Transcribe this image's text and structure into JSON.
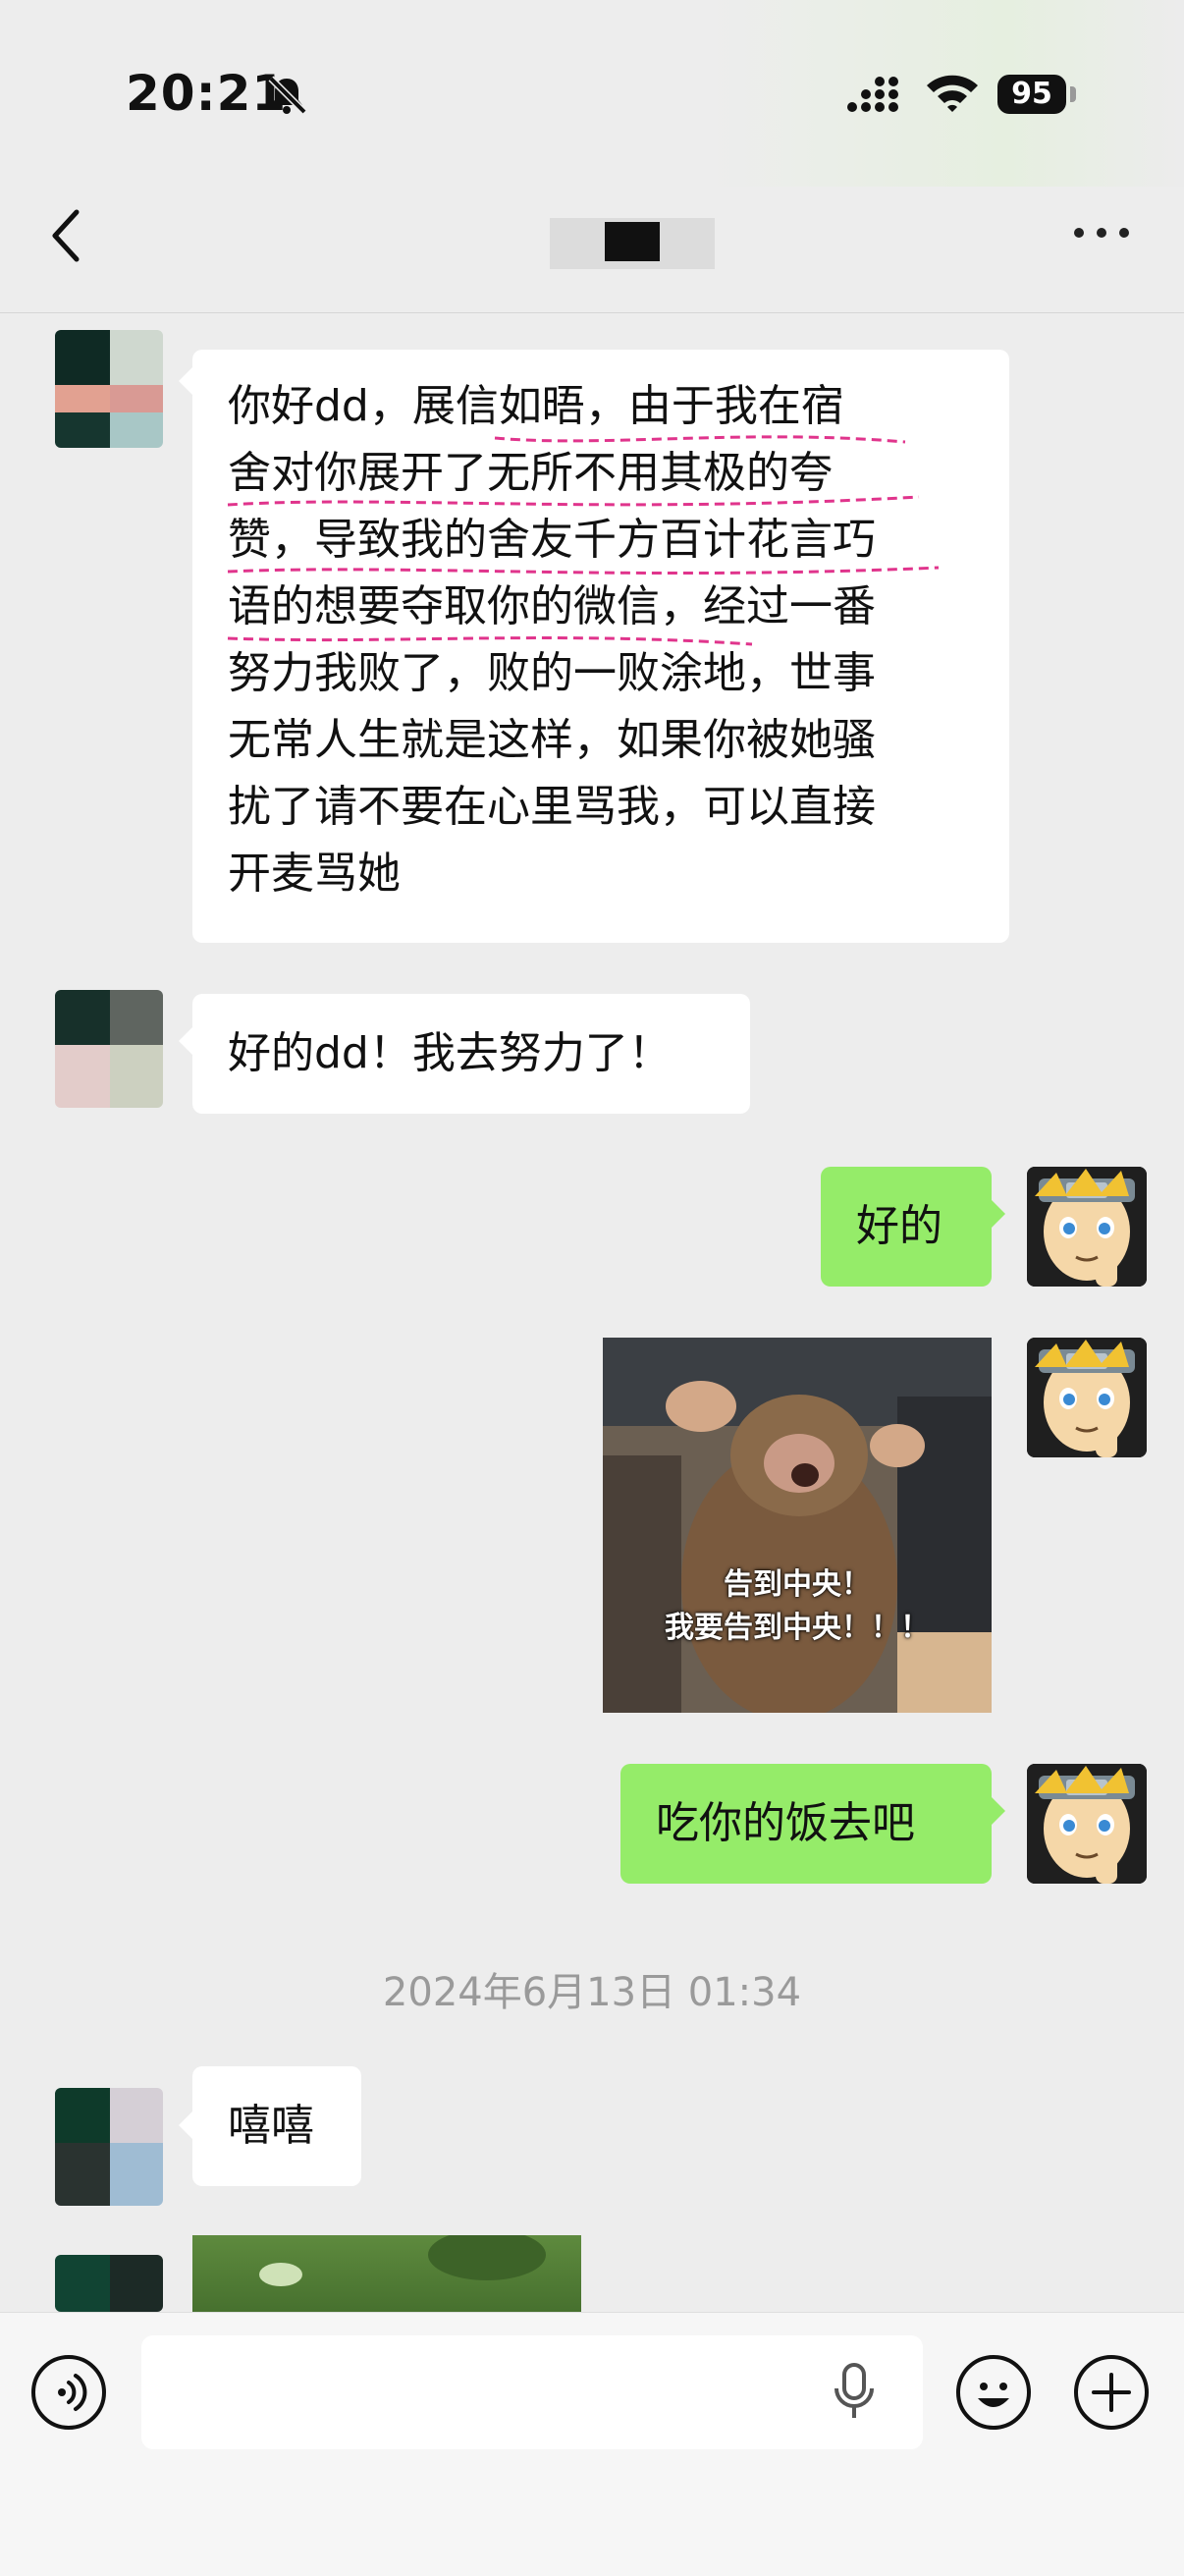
{
  "status_bar": {
    "time": "20:21",
    "battery": "95"
  },
  "chat": {
    "title": "",
    "messages": [
      {
        "side": "left",
        "lines": [
          "你好dd，展信如晤，由于我在宿",
          "舍对你展开了无所不用其极的夸",
          "赞，导致我的舍友千方百计花言巧",
          "语的想要夺取你的微信，经过一番",
          "努力我败了，败的一败涂地，世事",
          "无常人生就是这样，如果你被她骚",
          "扰了请不要在心里骂我，可以直接",
          "开麦骂她"
        ]
      },
      {
        "side": "left",
        "text": "好的dd！我去努力了！"
      },
      {
        "side": "right",
        "text": "好的"
      },
      {
        "side": "right",
        "type": "image",
        "caption_lines": [
          "告到中央！",
          "我要告到中央！！！"
        ]
      },
      {
        "side": "right",
        "text": "吃你的饭去吧"
      },
      {
        "side": "left",
        "text": "嘻嘻"
      }
    ],
    "timestamp": "2024年6月13日 01:34"
  },
  "input_bar": {
    "value": ""
  },
  "colors": {
    "background": "#ededed",
    "outgoing_bubble": "#95ec69",
    "incoming_bubble": "#ffffff",
    "timestamp": "#9a9a9a"
  },
  "icons": [
    "back-arrow-icon",
    "more-icon",
    "voice-icon",
    "microphone-icon",
    "emoji-icon",
    "plus-icon",
    "bell-mute-icon",
    "signal-icon",
    "wifi-icon"
  ]
}
